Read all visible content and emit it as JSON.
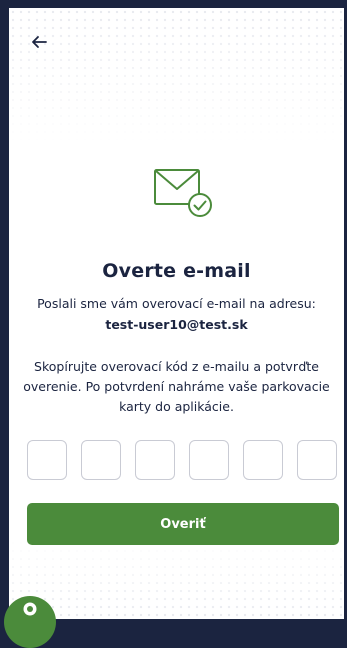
{
  "screen": {
    "title": "Overte e-mail",
    "sent_text": "Poslali sme vám overovací e-mail na adresu:",
    "email": "test-user10@test.sk",
    "instructions": "Skopírujte overovací kód z e-mailu a potvrďte overenie. Po potvrdení nahráme vaše parkovacie karty do aplikácie."
  },
  "code_inputs": [
    "",
    "",
    "",
    "",
    "",
    ""
  ],
  "verify_button": {
    "label": "Overiť"
  },
  "icons": {
    "back": "arrow-left-icon",
    "mail": "envelope-check-icon",
    "help": "help-chat-icon"
  },
  "colors": {
    "background": "#1b2440",
    "text": "#1b2440",
    "accent": "#4b8b3b",
    "input_border": "#c9cbd4"
  }
}
